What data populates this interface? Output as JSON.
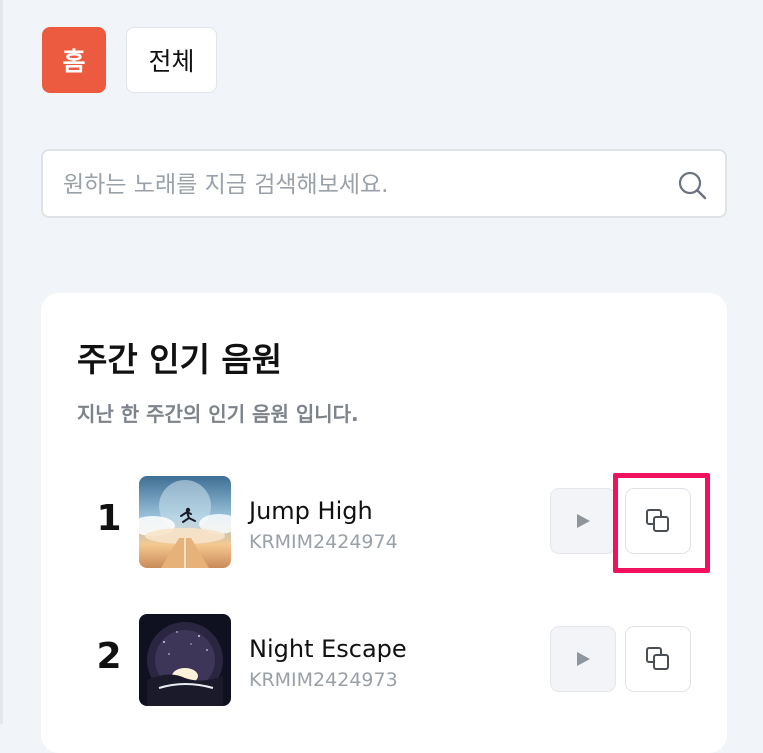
{
  "nav": {
    "home_label": "홈",
    "all_label": "전체"
  },
  "search": {
    "placeholder": "원하는 노래를 지금 검색해보세요.",
    "value": ""
  },
  "popular": {
    "title": "주간 인기 음원",
    "subtitle": "지난 한 주간의 인기 음원 입니다.",
    "songs": [
      {
        "rank": "1",
        "title": "Jump High",
        "code": "KRMIM2424974",
        "highlighted": true
      },
      {
        "rank": "2",
        "title": "Night Escape",
        "code": "KRMIM2424973",
        "highlighted": false
      }
    ]
  },
  "colors": {
    "accent": "#ec5a3f",
    "highlight": "#f0115f",
    "background": "#f1f4f8"
  },
  "icons": {
    "search": "search-icon",
    "play": "play-icon",
    "copy": "copy-icon"
  }
}
